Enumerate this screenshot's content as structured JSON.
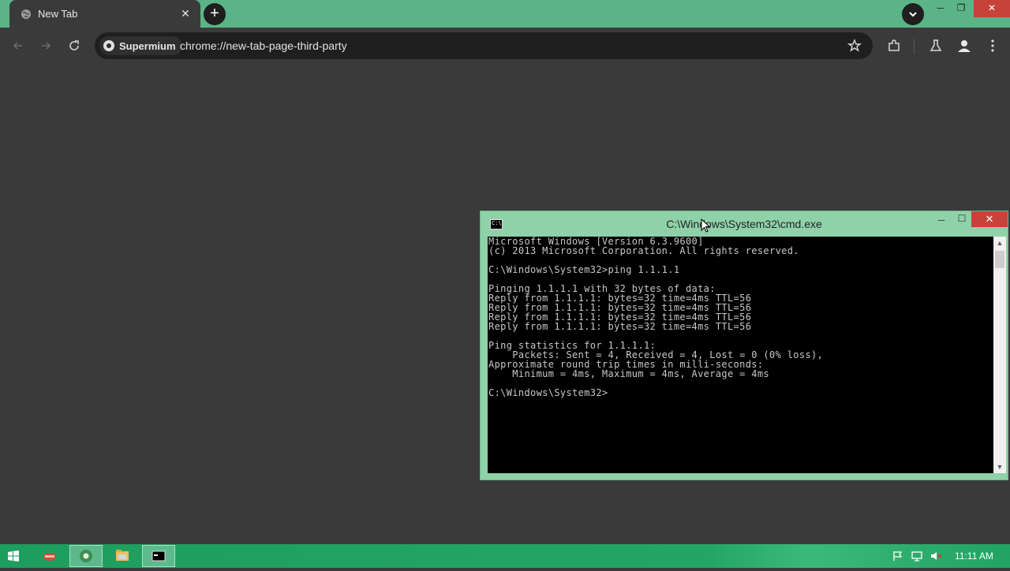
{
  "browser": {
    "tab_title": "New Tab",
    "tab_close": "✕",
    "new_tab": "+",
    "site_chip_label": "Supermium",
    "url": "chrome://new-tab-page-third-party",
    "window_min": "─",
    "window_max": "❐",
    "window_close": "✕"
  },
  "cmd": {
    "title": "C:\\Windows\\System32\\cmd.exe",
    "icon_label": "C:\\",
    "min": "─",
    "max": "☐",
    "close": "✕",
    "lines": [
      "Microsoft Windows [Version 6.3.9600]",
      "(c) 2013 Microsoft Corporation. All rights reserved.",
      "",
      "C:\\Windows\\System32>ping 1.1.1.1",
      "",
      "Pinging 1.1.1.1 with 32 bytes of data:",
      "Reply from 1.1.1.1: bytes=32 time=4ms TTL=56",
      "Reply from 1.1.1.1: bytes=32 time=4ms TTL=56",
      "Reply from 1.1.1.1: bytes=32 time=4ms TTL=56",
      "Reply from 1.1.1.1: bytes=32 time=4ms TTL=56",
      "",
      "Ping statistics for 1.1.1.1:",
      "    Packets: Sent = 4, Received = 4, Lost = 0 (0% loss),",
      "Approximate round trip times in milli-seconds:",
      "    Minimum = 4ms, Maximum = 4ms, Average = 4ms",
      "",
      "C:\\Windows\\System32>"
    ]
  },
  "taskbar": {
    "clock": "11:11 AM",
    "apps": [
      "cpanel-icon",
      "browser-icon",
      "file-explorer-icon",
      "cmd-icon"
    ]
  },
  "colors": {
    "accent": "#5bb487",
    "taskbar": "#21a362",
    "close_red": "#c7433a"
  }
}
